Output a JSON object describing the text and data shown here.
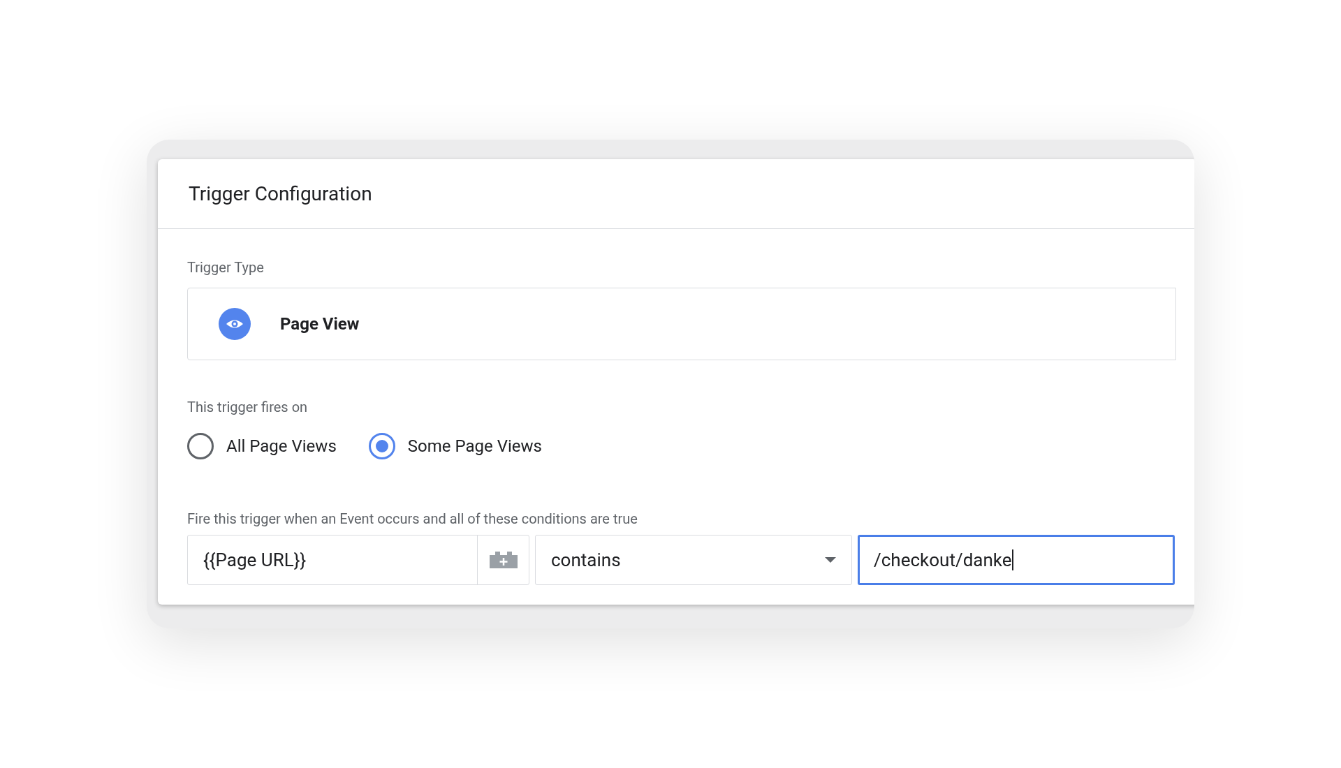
{
  "card": {
    "title": "Trigger Configuration"
  },
  "trigger_type": {
    "label": "Trigger Type",
    "name": "Page View"
  },
  "fires_on": {
    "label": "This trigger fires on",
    "options": [
      {
        "label": "All Page Views",
        "selected": false
      },
      {
        "label": "Some Page Views",
        "selected": true
      }
    ]
  },
  "conditions": {
    "label": "Fire this trigger when an Event occurs and all of these conditions are true",
    "variable": "{{Page URL}}",
    "operator": "contains",
    "value": {
      "text": "/checkout/danke",
      "focused": true
    }
  }
}
